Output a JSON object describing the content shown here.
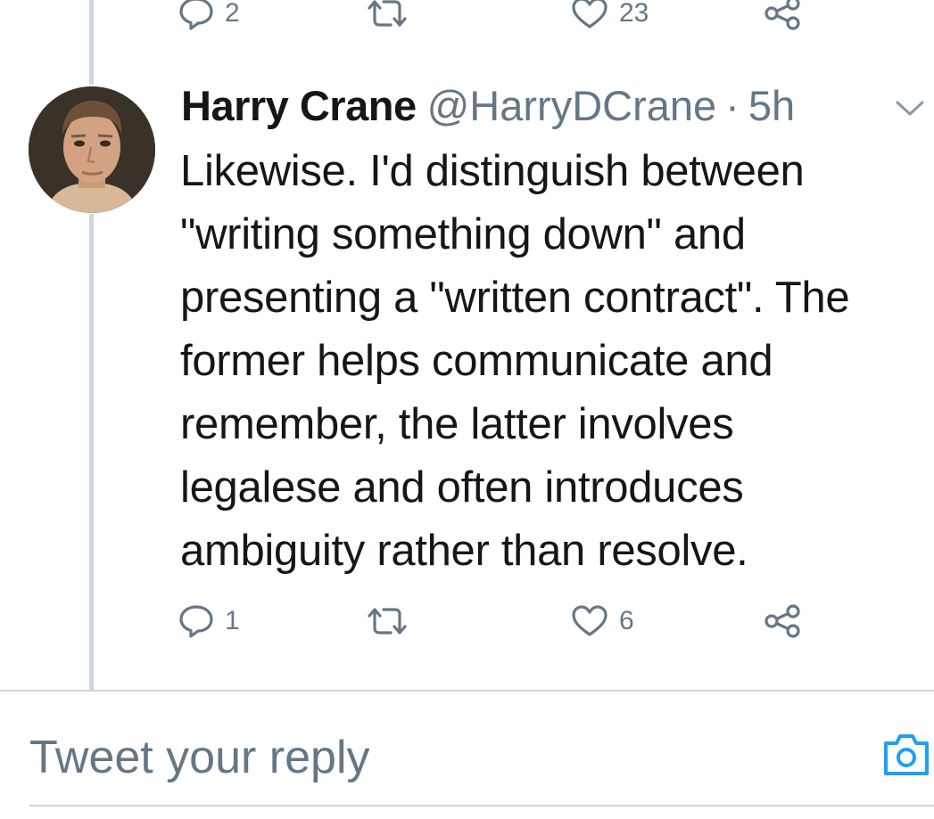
{
  "previous_tweet": {
    "actions": {
      "reply_count": "2",
      "like_count": "23"
    }
  },
  "tweet": {
    "author": {
      "display_name": "Harry Crane",
      "handle": "@HarryDCrane"
    },
    "separator": "·",
    "time": "5h",
    "body_lines": [
      "Likewise. I'd distinguish between",
      "\"writing something down\" and",
      "presenting a \"written contract\". The",
      "former helps communicate and",
      "remember, the latter involves",
      "legalese and often introduces",
      "ambiguity rather than resolve."
    ],
    "actions": {
      "reply_count": "1",
      "like_count": "6"
    }
  },
  "reply_box": {
    "placeholder": "Tweet your reply"
  },
  "colors": {
    "text_primary": "#14171a",
    "text_secondary": "#657786",
    "divider": "#ccd6dd",
    "accent": "#1da1f2"
  },
  "icons": [
    "reply-icon",
    "retweet-icon",
    "like-icon",
    "share-icon",
    "caret-down-icon",
    "camera-icon"
  ]
}
